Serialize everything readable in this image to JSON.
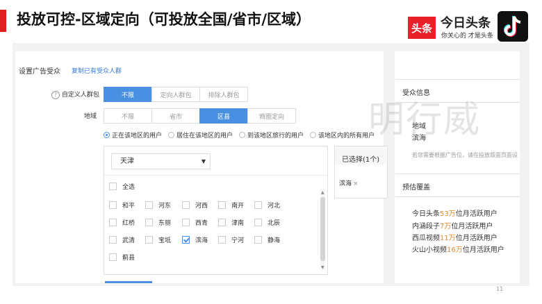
{
  "slide": {
    "title": "投放可控-区域定向（可投放全国/省市/区域）",
    "page_number": "11",
    "watermark": "明行威"
  },
  "branding": {
    "toutiao_badge": "头条",
    "toutiao_name": "今日头条",
    "toutiao_slogan": "你关心的 才是头条",
    "accent_color": "#e02020",
    "icons": [
      "tiktok-icon"
    ]
  },
  "form": {
    "section_title": "设置广告受众",
    "copy_link": "复制已有受众人群",
    "custom_audience": {
      "label": "自定义人群包",
      "options": [
        "不限",
        "定向人群包",
        "排除人群包"
      ],
      "active_index": 0
    },
    "region": {
      "label": "地域",
      "options": [
        "不限",
        "省市",
        "区县",
        "商圈定向"
      ],
      "active_index": 2,
      "radios": [
        "正在该地区的用户",
        "居住在该地区的用户",
        "到该地区旅行的用户",
        "该地区内的所有用户"
      ],
      "radio_selected": 0,
      "dropdown_value": "天津",
      "select_all": "全选",
      "districts": [
        "和平",
        "河东",
        "河西",
        "南开",
        "河北",
        "红桥",
        "东丽",
        "西青",
        "津南",
        "北辰",
        "武清",
        "宝坻",
        "滨海",
        "宁河",
        "静海",
        "蓟县"
      ],
      "checked": [
        "滨海"
      ]
    },
    "selected": {
      "title": "已选择(1个)",
      "items": [
        "滨海"
      ]
    },
    "primary_color": "#4a90e2"
  },
  "right_panel": {
    "audience_title": "受众信息",
    "audience_text1": "地域",
    "audience_text2": "滨海",
    "audience_hint": "若您需要根据广告位，请在投放版面页面设",
    "forecast_title": "预估覆盖",
    "forecast": [
      {
        "prefix": "今日头条",
        "num": "53万",
        "suffix": "位月活跃用户"
      },
      {
        "prefix": "内涵段子",
        "num": "7万",
        "suffix": "位月活跃用户"
      },
      {
        "prefix": "西瓜视频",
        "num": "11万",
        "suffix": "位月活跃用户"
      },
      {
        "prefix": "火山小视频",
        "num": "16万",
        "suffix": "位月活跃用户"
      }
    ],
    "number_color": "#e08a2e"
  }
}
